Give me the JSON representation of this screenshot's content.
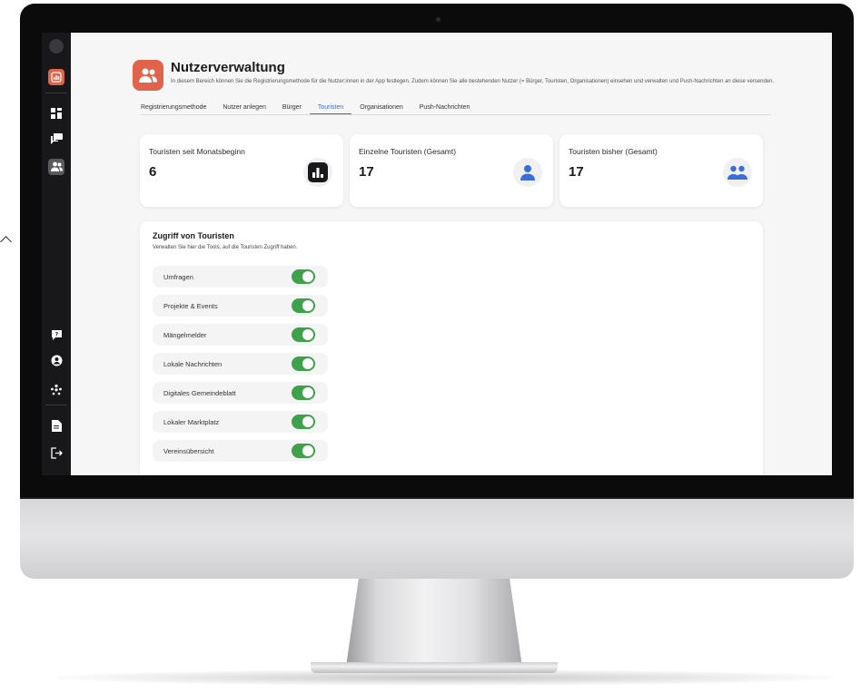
{
  "page": {
    "title": "Nutzerverwaltung",
    "description": "In diesem Bereich können Sie die Registrierungsmethode für die Nutzer:innen in der App festlegen. Zudem können Sie alle bestehenden Nutzer (= Bürger, Touristen, Organisationen) einsehen und verwalten und Push-Nachrichten an diese versenden."
  },
  "tabs": [
    {
      "label": "Registrierungsmethode",
      "active": false
    },
    {
      "label": "Nutzer anlegen",
      "active": false
    },
    {
      "label": "Bürger",
      "active": false
    },
    {
      "label": "Touristen",
      "active": true
    },
    {
      "label": "Organisationen",
      "active": false
    },
    {
      "label": "Push-Nachrichten",
      "active": false
    }
  ],
  "stats": [
    {
      "label": "Touristen seit Monatsbeginn",
      "value": "6",
      "icon": "chart-icon"
    },
    {
      "label": "Einzelne Touristen (Gesamt)",
      "value": "17",
      "icon": "user-icon"
    },
    {
      "label": "Touristen bisher (Gesamt)",
      "value": "17",
      "icon": "users-icon"
    }
  ],
  "access": {
    "title": "Zugriff von Touristen",
    "description": "Verwalten Sie hier die Tools, auf die Touristen Zugriff haben.",
    "tools": [
      {
        "label": "Umfragen",
        "enabled": true
      },
      {
        "label": "Projekte & Events",
        "enabled": true
      },
      {
        "label": "Mängelmelder",
        "enabled": true
      },
      {
        "label": "Lokale Nachrichten",
        "enabled": true
      },
      {
        "label": "Digitales Gemeindeblatt",
        "enabled": true
      },
      {
        "label": "Lokaler Marktplatz",
        "enabled": true
      },
      {
        "label": "Vereinsübersicht",
        "enabled": true
      }
    ]
  },
  "sidebar": {
    "items": [
      {
        "icon": "avatar-icon"
      },
      {
        "icon": "analytics-icon"
      },
      {
        "icon": "dashboard-icon"
      },
      {
        "icon": "chat-icon"
      },
      {
        "icon": "users-icon",
        "active": true
      },
      {
        "icon": "help-icon"
      },
      {
        "icon": "profile-icon"
      },
      {
        "icon": "community-icon"
      },
      {
        "icon": "document-icon"
      },
      {
        "icon": "logout-icon"
      }
    ]
  },
  "colors": {
    "accent": "#3b6fd8",
    "header_icon": "#e0644a",
    "toggle_on": "#3fa14b",
    "sidebar_bg": "#18181a",
    "analytics_icon": "#e0644a"
  }
}
